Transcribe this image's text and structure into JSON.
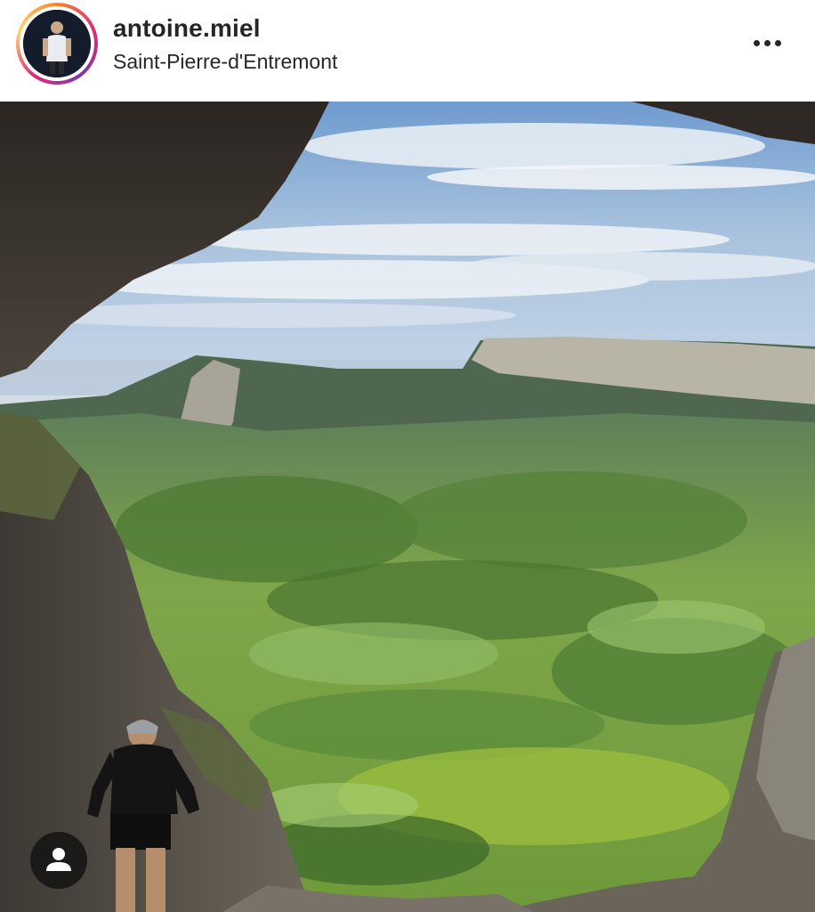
{
  "post": {
    "username": "antoine.miel",
    "location": "Saint-Pierre-d'Entremont",
    "more_icon": "more-horizontal-icon",
    "tag_icon": "user-tag-icon",
    "image_alt": "Hiker climbing out of a cave overlooking a green mountain valley with cliffs"
  },
  "colors": {
    "text": "#262626",
    "sky": "#8fb2d6",
    "valley_green": "#7fa64a",
    "rock": "#5a544c"
  }
}
